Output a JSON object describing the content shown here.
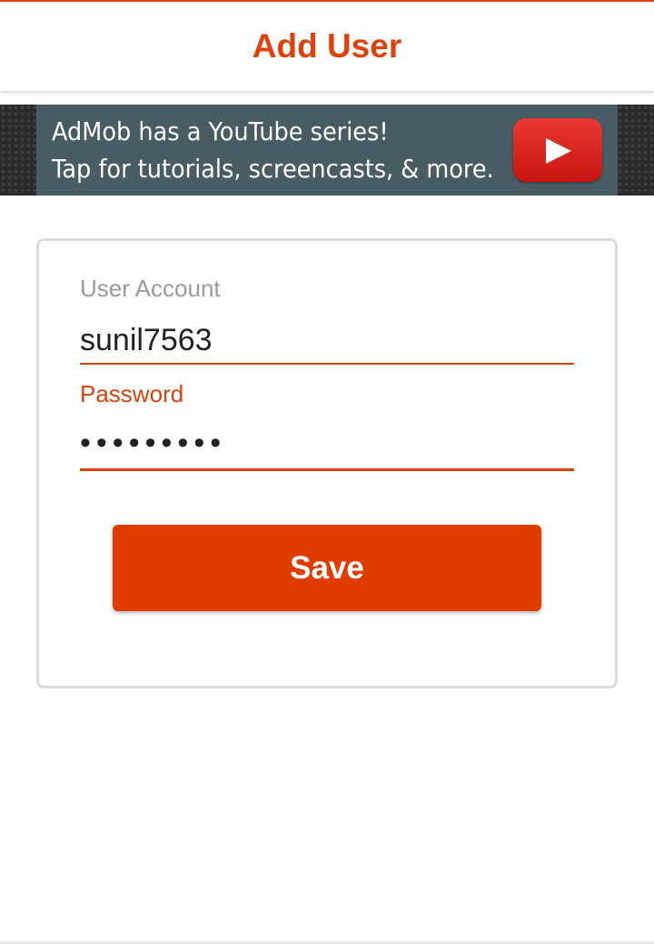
{
  "app_bar": {
    "title": "Add User"
  },
  "ad": {
    "line1": "AdMob has a YouTube series!",
    "line2": "Tap for tutorials, screencasts, & more.",
    "icon": "youtube-play-icon"
  },
  "form": {
    "account": {
      "label": "User Account",
      "value": "sunil7563"
    },
    "password": {
      "label": "Password",
      "value": "•••••••••"
    },
    "save_label": "Save"
  },
  "colors": {
    "accent": "#e0400a",
    "ad_panel": "#485c63",
    "label_inactive": "#9a9a9a"
  }
}
